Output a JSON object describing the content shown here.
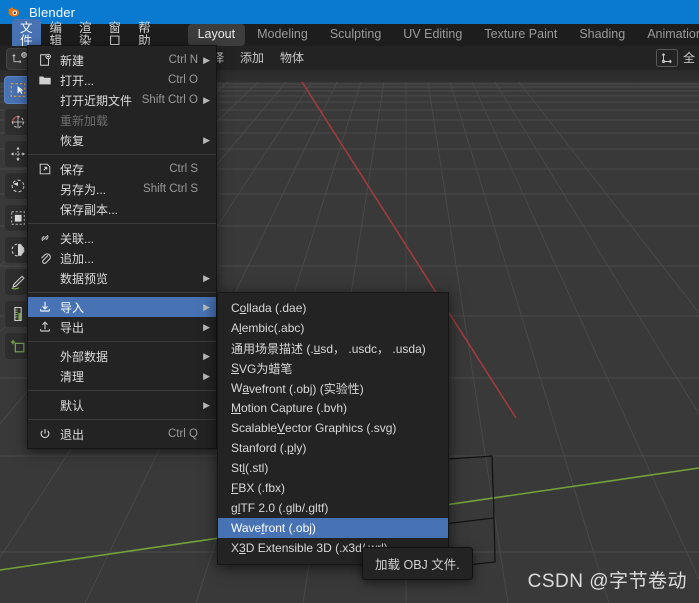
{
  "window": {
    "title": "Blender",
    "logo_icon": "blender-logo-icon",
    "titlebar_color": "#0a7ad0"
  },
  "menubar": {
    "app_icon": "blender-logo-icon",
    "items": [
      {
        "label": "文件",
        "active": true
      },
      {
        "label": "编辑",
        "active": false
      },
      {
        "label": "渲染",
        "active": false
      },
      {
        "label": "窗口",
        "active": false
      },
      {
        "label": "帮助",
        "active": false
      }
    ]
  },
  "workspace_tabs": [
    {
      "label": "Layout",
      "active": true
    },
    {
      "label": "Modeling",
      "active": false
    },
    {
      "label": "Sculpting",
      "active": false
    },
    {
      "label": "UV Editing",
      "active": false
    },
    {
      "label": "Texture Paint",
      "active": false
    },
    {
      "label": "Shading",
      "active": false
    },
    {
      "label": "Animation",
      "active": false
    }
  ],
  "viewport_header": {
    "items": [
      {
        "label": "择"
      },
      {
        "label": "添加"
      },
      {
        "label": "物体"
      }
    ],
    "right_icons": [
      {
        "name": "transform-orientation-icon"
      },
      {
        "name": "snap-magnet-icon"
      }
    ],
    "right_label": "全"
  },
  "left_toolbar": {
    "gizmo_icon": "cursor-gizmo-icon",
    "tools": [
      {
        "name": "tweak-select-box-tool",
        "icon": "select-box-icon",
        "active": true
      },
      {
        "name": "cursor-tool",
        "icon": "cursor-3d-icon",
        "active": false
      },
      {
        "name": "move-tool",
        "icon": "move-arrows-icon",
        "active": false
      },
      {
        "name": "rotate-tool",
        "icon": "rotate-arc-icon",
        "active": false
      },
      {
        "name": "scale-tool",
        "icon": "scale-square-icon",
        "active": false
      },
      {
        "name": "transform-tool",
        "icon": "transform-icon",
        "active": false
      },
      {
        "name": "annotate-tool",
        "icon": "annotate-pencil-icon",
        "active": false
      },
      {
        "name": "measure-tool",
        "icon": "measure-ruler-icon",
        "active": false
      },
      {
        "name": "add-cube-tool",
        "icon": "add-cube-icon",
        "active": false
      }
    ]
  },
  "file_menu": {
    "items": [
      {
        "kind": "item",
        "icon": "new-file-icon",
        "label": "新建",
        "shortcut": "Ctrl N",
        "arrow": true,
        "highlighted": false,
        "disabled": false
      },
      {
        "kind": "item",
        "icon": "open-folder-icon",
        "label": "打开...",
        "shortcut": "Ctrl O",
        "arrow": false,
        "highlighted": false,
        "disabled": false
      },
      {
        "kind": "item",
        "icon": "",
        "label": "打开近期文件",
        "shortcut": "Shift Ctrl O",
        "arrow": true,
        "highlighted": false,
        "disabled": false
      },
      {
        "kind": "item",
        "icon": "",
        "label": "重新加载",
        "shortcut": "",
        "arrow": false,
        "highlighted": false,
        "disabled": true
      },
      {
        "kind": "item",
        "icon": "",
        "label": "恢复",
        "shortcut": "",
        "arrow": true,
        "highlighted": false,
        "disabled": false
      },
      {
        "kind": "sep"
      },
      {
        "kind": "item",
        "icon": "save-icon",
        "label": "保存",
        "shortcut": "Ctrl S",
        "arrow": false,
        "highlighted": false,
        "disabled": false
      },
      {
        "kind": "item",
        "icon": "",
        "label": "另存为...",
        "shortcut": "Shift Ctrl S",
        "arrow": false,
        "highlighted": false,
        "disabled": false
      },
      {
        "kind": "item",
        "icon": "",
        "label": "保存副本...",
        "shortcut": "",
        "arrow": false,
        "highlighted": false,
        "disabled": false
      },
      {
        "kind": "sep"
      },
      {
        "kind": "item",
        "icon": "link-chain-icon",
        "label": "关联...",
        "shortcut": "",
        "arrow": false,
        "highlighted": false,
        "disabled": false
      },
      {
        "kind": "item",
        "icon": "paperclip-icon",
        "label": "追加...",
        "shortcut": "",
        "arrow": false,
        "highlighted": false,
        "disabled": false
      },
      {
        "kind": "item",
        "icon": "",
        "label": "数据预览",
        "shortcut": "",
        "arrow": true,
        "highlighted": false,
        "disabled": false
      },
      {
        "kind": "sep"
      },
      {
        "kind": "item",
        "icon": "import-icon",
        "label": "导入",
        "shortcut": "",
        "arrow": true,
        "highlighted": true,
        "disabled": false
      },
      {
        "kind": "item",
        "icon": "export-icon",
        "label": "导出",
        "shortcut": "",
        "arrow": true,
        "highlighted": false,
        "disabled": false
      },
      {
        "kind": "sep"
      },
      {
        "kind": "item",
        "icon": "",
        "label": "外部数据",
        "shortcut": "",
        "arrow": true,
        "highlighted": false,
        "disabled": false
      },
      {
        "kind": "item",
        "icon": "",
        "label": "清理",
        "shortcut": "",
        "arrow": true,
        "highlighted": false,
        "disabled": false
      },
      {
        "kind": "sep"
      },
      {
        "kind": "item",
        "icon": "",
        "label": "默认",
        "shortcut": "",
        "arrow": true,
        "highlighted": false,
        "disabled": false
      },
      {
        "kind": "sep"
      },
      {
        "kind": "item",
        "icon": "power-icon",
        "label": "退出",
        "shortcut": "Ctrl Q",
        "arrow": false,
        "highlighted": false,
        "disabled": false
      }
    ]
  },
  "import_submenu": {
    "items": [
      {
        "pre": "C",
        "acc": "o",
        "post": "llada (.dae)",
        "highlighted": false
      },
      {
        "pre": "A",
        "acc": "l",
        "post": "embic(.abc)",
        "highlighted": false
      },
      {
        "pre": "通用场景描述 (.",
        "acc": "u",
        "post": "sd， .usdc， .usda)",
        "highlighted": false
      },
      {
        "pre": "",
        "acc": "S",
        "post": "VG为蜡笔",
        "highlighted": false
      },
      {
        "pre": "W",
        "acc": "a",
        "post": "vefront (.obj) (实验性)",
        "highlighted": false
      },
      {
        "pre": "",
        "acc": "M",
        "post": "otion Capture (.bvh)",
        "highlighted": false
      },
      {
        "pre": "Scalable ",
        "acc": "V",
        "post": "ector Graphics (.svg)",
        "highlighted": false
      },
      {
        "pre": "Stanford (.",
        "acc": "p",
        "post": "ly)",
        "highlighted": false
      },
      {
        "pre": "St",
        "acc": "l",
        "post": " (.stl)",
        "highlighted": false
      },
      {
        "pre": "",
        "acc": "F",
        "post": "BX (.fbx)",
        "highlighted": false
      },
      {
        "pre": "g",
        "acc": "l",
        "post": "TF 2.0 (.glb/.gltf)",
        "highlighted": false
      },
      {
        "pre": "Wave",
        "acc": "f",
        "post": "ront (.obj)",
        "highlighted": true
      },
      {
        "pre": "X",
        "acc": "3",
        "post": "D Extensible 3D (.x3d/.wrl)",
        "highlighted": false
      }
    ]
  },
  "tooltip": {
    "text": "加载 OBJ 文件."
  },
  "watermark": {
    "text": "CSDN @字节卷动"
  },
  "colors": {
    "accent_blue": "#4772b3",
    "titlebar_blue": "#0a7ad0",
    "blender_orange": "#ea7600",
    "menu_bg": "#232323",
    "viewport_bg": "#393939",
    "axis_x_red": "#a63b3e",
    "axis_y_green": "#74a33a"
  }
}
